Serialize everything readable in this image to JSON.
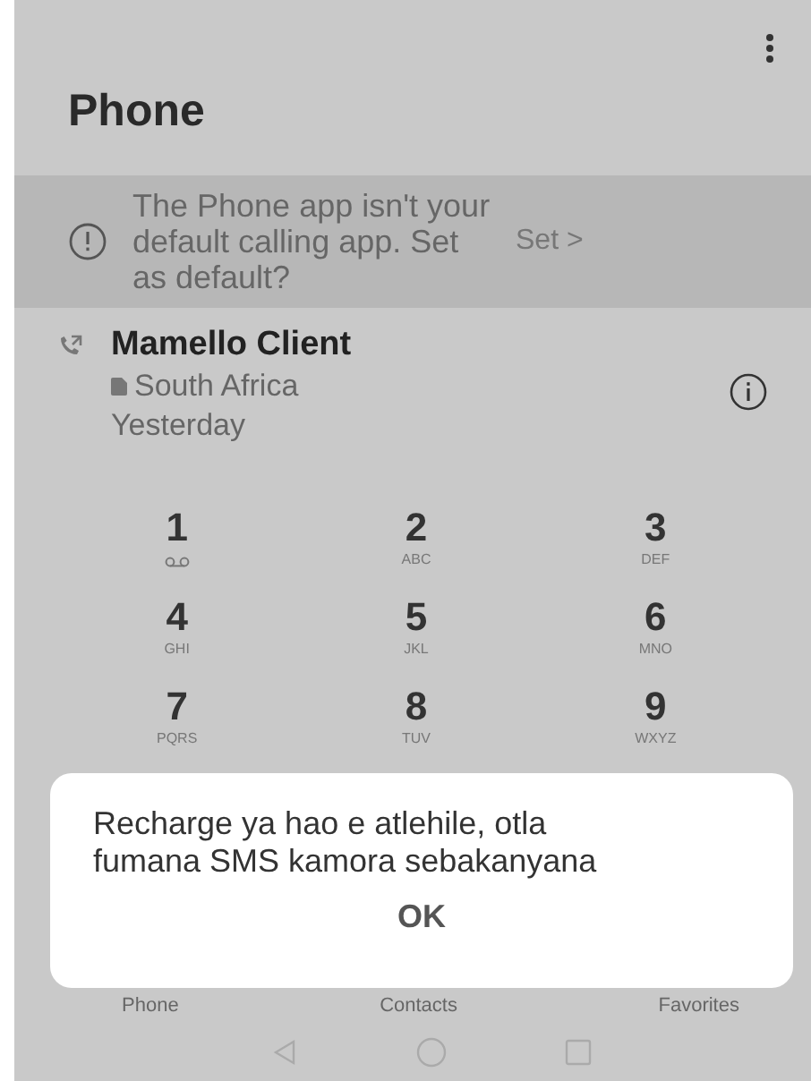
{
  "app_bar": {
    "title": "Phone"
  },
  "banner": {
    "message": "The Phone app isn't your default calling app. Set as default?",
    "action": "Set >"
  },
  "call_log": [
    {
      "name": "Mamello Client",
      "location": "South Africa",
      "time": "Yesterday"
    }
  ],
  "keypad": [
    {
      "digit": "1",
      "kind": "voicemail"
    },
    {
      "digit": "2",
      "kind": "letters",
      "letters": "ABC"
    },
    {
      "digit": "3",
      "kind": "letters",
      "letters": "DEF"
    },
    {
      "digit": "4",
      "kind": "letters",
      "letters": "GHI"
    },
    {
      "digit": "5",
      "kind": "letters",
      "letters": "JKL"
    },
    {
      "digit": "6",
      "kind": "letters",
      "letters": "MNO"
    },
    {
      "digit": "7",
      "kind": "letters",
      "letters": "PQRS"
    },
    {
      "digit": "8",
      "kind": "letters",
      "letters": "TUV"
    },
    {
      "digit": "9",
      "kind": "letters",
      "letters": "WXYZ"
    }
  ],
  "dialog": {
    "message": "Recharge ya hao e atlehile, otla fumana SMS kamora sebakanyana",
    "button": "OK"
  },
  "bottom_tabs": [
    {
      "label": "Phone"
    },
    {
      "label": "Contacts"
    },
    {
      "label": "Favorites"
    }
  ]
}
